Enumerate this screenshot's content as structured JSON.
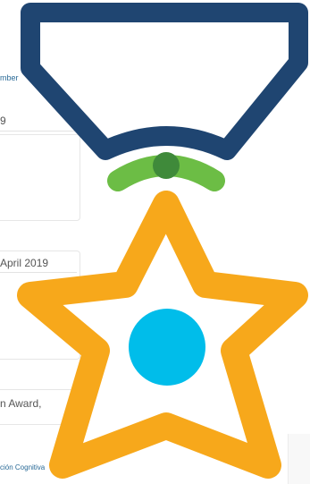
{
  "background_ui": {
    "top_link": "mber",
    "field_1_value": "9",
    "card_2_date": "April 2019",
    "card_3_text": "n Award,",
    "footer_link": "ción Cognitiva"
  },
  "medal": {
    "ribbon_color": "#1f4571",
    "ring_color": "#6cbd45",
    "ring_knot_color": "#3f8a3a",
    "star_color": "#f7a81b",
    "center_dot_color": "#00bdea",
    "icon_name": "medal-icon"
  }
}
